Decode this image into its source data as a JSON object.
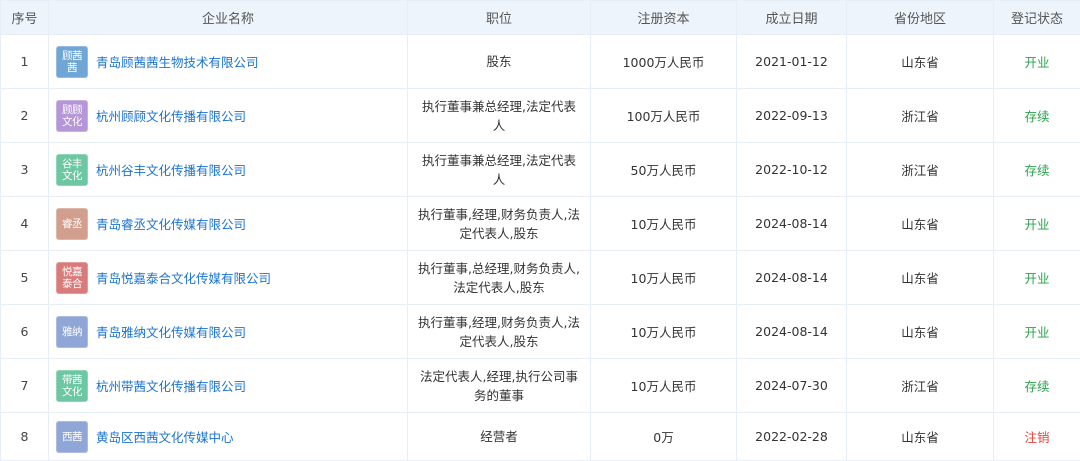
{
  "table": {
    "headers": {
      "seq": "序号",
      "name": "企业名称",
      "role": "职位",
      "capital": "注册资本",
      "date": "成立日期",
      "province": "省份地区",
      "status": "登记状态"
    },
    "rows": [
      {
        "seq": "1",
        "logo_top": "顾茜",
        "logo_bottom": "茜",
        "logo_color": "#6fa6d6",
        "name": "青岛顾茜茜生物技术有限公司",
        "role": "股东",
        "capital": "1000万人民币",
        "date": "2021-01-12",
        "province": "山东省",
        "status": "开业",
        "status_color": "#2aa34a"
      },
      {
        "seq": "2",
        "logo_top": "顾顾",
        "logo_bottom": "文化",
        "logo_color": "#b596d8",
        "name": "杭州顾顾文化传播有限公司",
        "role": "执行董事兼总经理,法定代表人",
        "capital": "100万人民币",
        "date": "2022-09-13",
        "province": "浙江省",
        "status": "存续",
        "status_color": "#2aa34a"
      },
      {
        "seq": "3",
        "logo_top": "谷丰",
        "logo_bottom": "文化",
        "logo_color": "#6cc7a2",
        "name": "杭州谷丰文化传播有限公司",
        "role": "执行董事兼总经理,法定代表人",
        "capital": "50万人民币",
        "date": "2022-10-12",
        "province": "浙江省",
        "status": "存续",
        "status_color": "#2aa34a"
      },
      {
        "seq": "4",
        "logo_top": "睿丞",
        "logo_bottom": "",
        "logo_color": "#d29f8e",
        "name": "青岛睿丞文化传媒有限公司",
        "role": "执行董事,经理,财务负责人,法定代表人,股东",
        "capital": "10万人民币",
        "date": "2024-08-14",
        "province": "山东省",
        "status": "开业",
        "status_color": "#2aa34a"
      },
      {
        "seq": "5",
        "logo_top": "悦嘉",
        "logo_bottom": "泰合",
        "logo_color": "#d97b7b",
        "name": "青岛悦嘉泰合文化传媒有限公司",
        "role": "执行董事,总经理,财务负责人,法定代表人,股东",
        "capital": "10万人民币",
        "date": "2024-08-14",
        "province": "山东省",
        "status": "开业",
        "status_color": "#2aa34a"
      },
      {
        "seq": "6",
        "logo_top": "雅纳",
        "logo_bottom": "",
        "logo_color": "#8fa6d6",
        "name": "青岛雅纳文化传媒有限公司",
        "role": "执行董事,经理,财务负责人,法定代表人,股东",
        "capital": "10万人民币",
        "date": "2024-08-14",
        "province": "山东省",
        "status": "开业",
        "status_color": "#2aa34a"
      },
      {
        "seq": "7",
        "logo_top": "带茜",
        "logo_bottom": "文化",
        "logo_color": "#6cc7a2",
        "name": "杭州带茜文化传播有限公司",
        "role": "法定代表人,经理,执行公司事务的董事",
        "capital": "10万人民币",
        "date": "2024-07-30",
        "province": "浙江省",
        "status": "存续",
        "status_color": "#2aa34a"
      },
      {
        "seq": "8",
        "logo_top": "西茜",
        "logo_bottom": "",
        "logo_color": "#8fa6d6",
        "name": "黄岛区西茜文化传媒中心",
        "role": "经营者",
        "capital": "0万",
        "date": "2022-02-28",
        "province": "山东省",
        "status": "注销",
        "status_color": "#e0463c"
      }
    ]
  }
}
